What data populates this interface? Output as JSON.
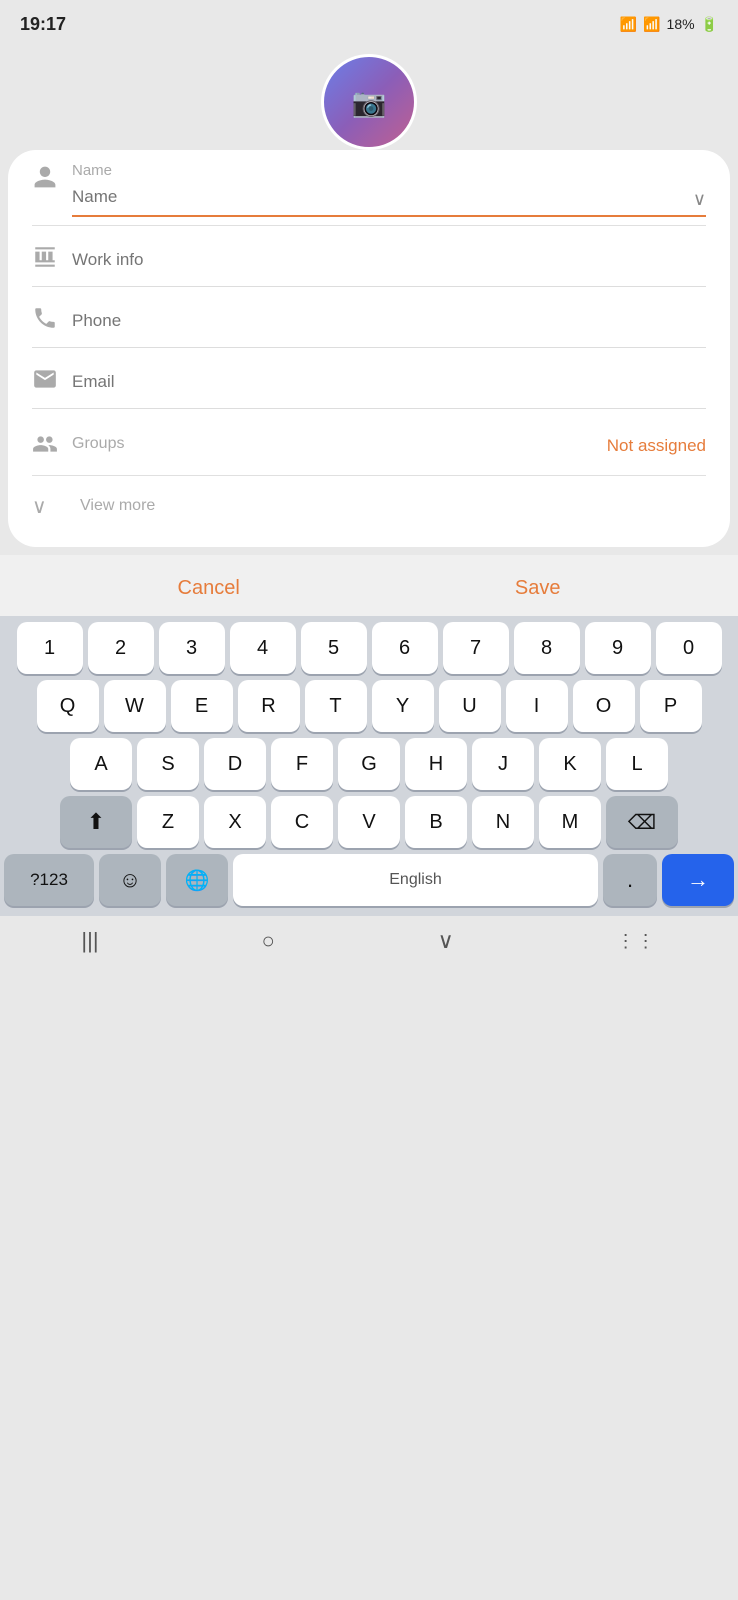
{
  "statusBar": {
    "time": "19:17",
    "battery": "18%",
    "batteryIcon": "🔋"
  },
  "form": {
    "fields": {
      "name": {
        "label": "Name",
        "placeholder": "Name"
      },
      "workInfo": {
        "placeholder": "Work info"
      },
      "phone": {
        "placeholder": "Phone"
      },
      "email": {
        "placeholder": "Email"
      },
      "groups": {
        "label": "Groups",
        "value": "Not assigned"
      }
    },
    "viewMore": "View more"
  },
  "actions": {
    "cancel": "Cancel",
    "save": "Save"
  },
  "keyboard": {
    "numbers": [
      "1",
      "2",
      "3",
      "4",
      "5",
      "6",
      "7",
      "8",
      "9",
      "0"
    ],
    "row1": [
      "Q",
      "W",
      "E",
      "R",
      "T",
      "Y",
      "U",
      "I",
      "O",
      "P"
    ],
    "row2": [
      "A",
      "S",
      "D",
      "F",
      "G",
      "H",
      "J",
      "K",
      "L"
    ],
    "row3": [
      "Z",
      "X",
      "C",
      "V",
      "B",
      "N",
      "M"
    ],
    "special": {
      "numeric": "?123",
      "emoji": "☺",
      "globe": "🌐",
      "spacebar": "English",
      "period": ".",
      "enter": "→"
    }
  },
  "bottomNav": {
    "back": "|||",
    "home": "○",
    "recent": "∨",
    "apps": "⋮⋮"
  }
}
